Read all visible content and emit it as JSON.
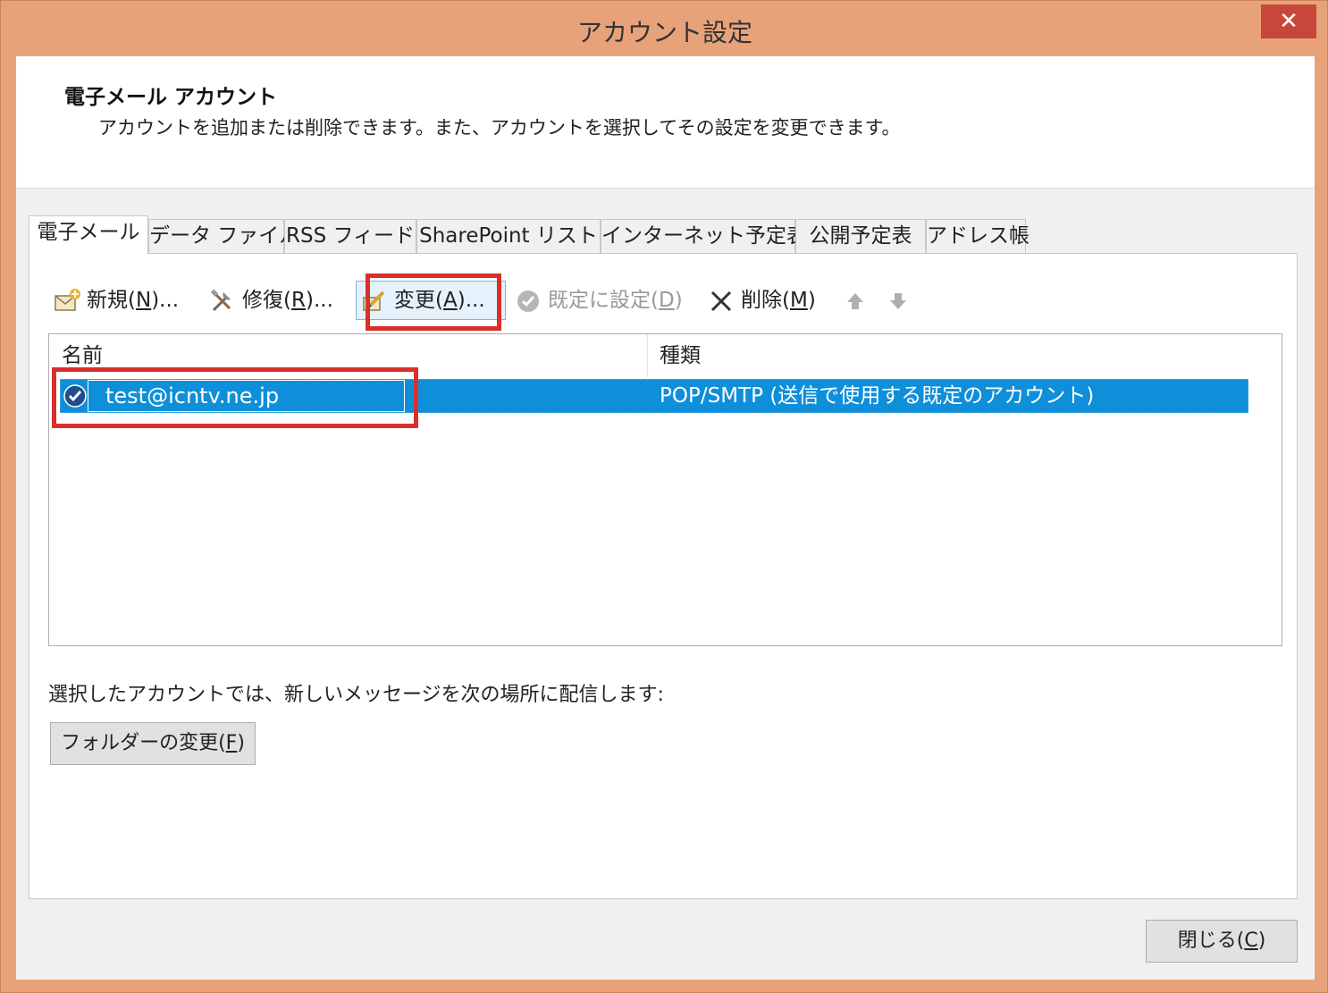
{
  "window": {
    "title": "アカウント設定",
    "close_glyph": "✕"
  },
  "header": {
    "title": "電子メール アカウント",
    "description": "アカウントを追加または削除できます。また、アカウントを選択してその設定を変更できます。"
  },
  "tabs": [
    {
      "label": "電子メール",
      "active": true
    },
    {
      "label": "データ ファイル",
      "active": false
    },
    {
      "label": "RSS フィード",
      "active": false
    },
    {
      "label": "SharePoint リスト",
      "active": false
    },
    {
      "label": "インターネット予定表",
      "active": false
    },
    {
      "label": "公開予定表",
      "active": false
    },
    {
      "label": "アドレス帳",
      "active": false
    }
  ],
  "toolbar": {
    "new": {
      "prefix": "新規(",
      "key": "N",
      "suffix": ")..."
    },
    "repair": {
      "prefix": "修復(",
      "key": "R",
      "suffix": ")..."
    },
    "change": {
      "prefix": "変更(",
      "key": "A",
      "suffix": ")..."
    },
    "set_default": {
      "prefix": "既定に設定(",
      "key": "D",
      "suffix": ")"
    },
    "delete": {
      "prefix": "削除(",
      "key": "M",
      "suffix": ")"
    },
    "up_icon": "arrow-up",
    "down_icon": "arrow-down"
  },
  "list": {
    "columns": [
      "名前",
      "種類"
    ],
    "rows": [
      {
        "name": "test@icntv.ne.jp",
        "type": "POP/SMTP (送信で使用する既定のアカウント)",
        "selected": true,
        "default": true
      }
    ]
  },
  "delivery": {
    "label": "選択したアカウントでは、新しいメッセージを次の場所に配信します:",
    "folder_button": {
      "prefix": "フォルダーの変更(",
      "key": "F",
      "suffix": ")"
    }
  },
  "footer": {
    "close_button": {
      "prefix": "閉じる(",
      "key": "C",
      "suffix": ")"
    }
  },
  "colors": {
    "frame": "#E8A27A",
    "selection": "#0F8FDA",
    "highlight_box": "#D9302C"
  }
}
